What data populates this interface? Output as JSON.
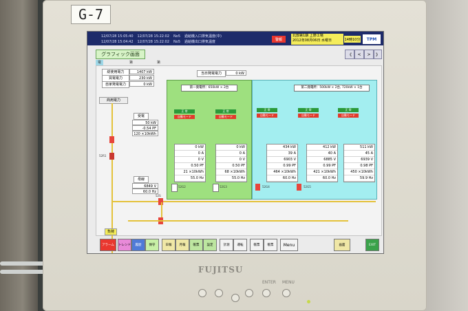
{
  "label_tag": "G-7",
  "brand": "FUJITSU",
  "controls": {
    "enter": "ENTER",
    "menu": "MENU"
  },
  "header": {
    "alarms": [
      {
        "time1": "12/07/28 15:05:40",
        "time2": "12/07/28 15:22:02",
        "code": "No5",
        "msg": "過給機入口排気温度(中)"
      },
      {
        "time1": "12/07/28 15:04:42",
        "time2": "12/07/28 15:22:02",
        "code": "No5",
        "msg": "過給機出口排気温度"
      }
    ],
    "alarm_btn": "警報",
    "plant": {
      "line1": "北部第1期  上野工場",
      "line2": "2012年08月06日  水曜日"
    },
    "time": "14時10分",
    "logo": "TPM"
  },
  "title": "グラフィック画面",
  "nav": [
    "《",
    "<",
    ">",
    "》"
  ],
  "tabs": [
    "電力系統図",
    "第1発電所",
    "第2発電所"
  ],
  "summary": [
    {
      "label": "総使用電力",
      "value": "1407 kW"
    },
    {
      "label": "買電電力",
      "value": "230 kW"
    },
    {
      "label": "自家発電電力",
      "value": "0 kW"
    }
  ],
  "sub_total": {
    "label": "当日発電電力",
    "value": "0 kW"
  },
  "receiving": "商用電力",
  "ju": {
    "label": "受電",
    "values": [
      "50 kW",
      "-0.54 PF",
      "120 ×10kWh"
    ]
  },
  "bus": {
    "label": "母線",
    "values": [
      "6849 V",
      "60.0 Hz"
    ]
  },
  "load": "負荷",
  "group1": {
    "title": "第一発電所：650kW × 2台",
    "units": [
      {
        "status": "正 常",
        "mode": "自動モード",
        "meas": [
          "0 kW",
          "0 A",
          "0 V",
          "0.50 PF",
          "21 ×10kWh",
          "55.0 Hz"
        ]
      },
      {
        "status": "正 常",
        "mode": "自動モード",
        "meas": [
          "0 kW",
          "0 A",
          "0 V",
          "0.50 PF",
          "68 ×10kWh",
          "55.0 Hz"
        ]
      }
    ]
  },
  "group2": {
    "title": "第二発電所：500kW × 2台, 720kW × 1台",
    "units": [
      {
        "status": "正 常",
        "mode": "自動モード",
        "meas": [
          "434 kW",
          "39 A",
          "6903 V",
          "0.99 PF",
          "464 ×10kWh",
          "60.0 Hz"
        ]
      },
      {
        "status": "正 常",
        "mode": "自動モード",
        "meas": [
          "412 kW",
          "40 A",
          "6885 V",
          "0.99 PF",
          "421 ×10kWh",
          "60.0 Hz"
        ]
      },
      {
        "status": "正 常",
        "mode": "自動モード",
        "meas": [
          "511 kW",
          "45 A",
          "6939 V",
          "0.98 PF",
          "450 ×10kWh",
          "59.9 Hz"
        ]
      }
    ]
  },
  "switches": [
    "52G1",
    "52G2",
    "52G3",
    "52G4",
    "52G5",
    "52R1",
    "52R2",
    "52S"
  ],
  "bottom_buttons": [
    "アラーム",
    "トレンド",
    "履歴",
    "保守",
    "日報",
    "月報",
    "帳票",
    "設定",
    "計測",
    "運転",
    "帳票",
    "帳票",
    "Menu",
    "画面",
    "EXIT"
  ]
}
